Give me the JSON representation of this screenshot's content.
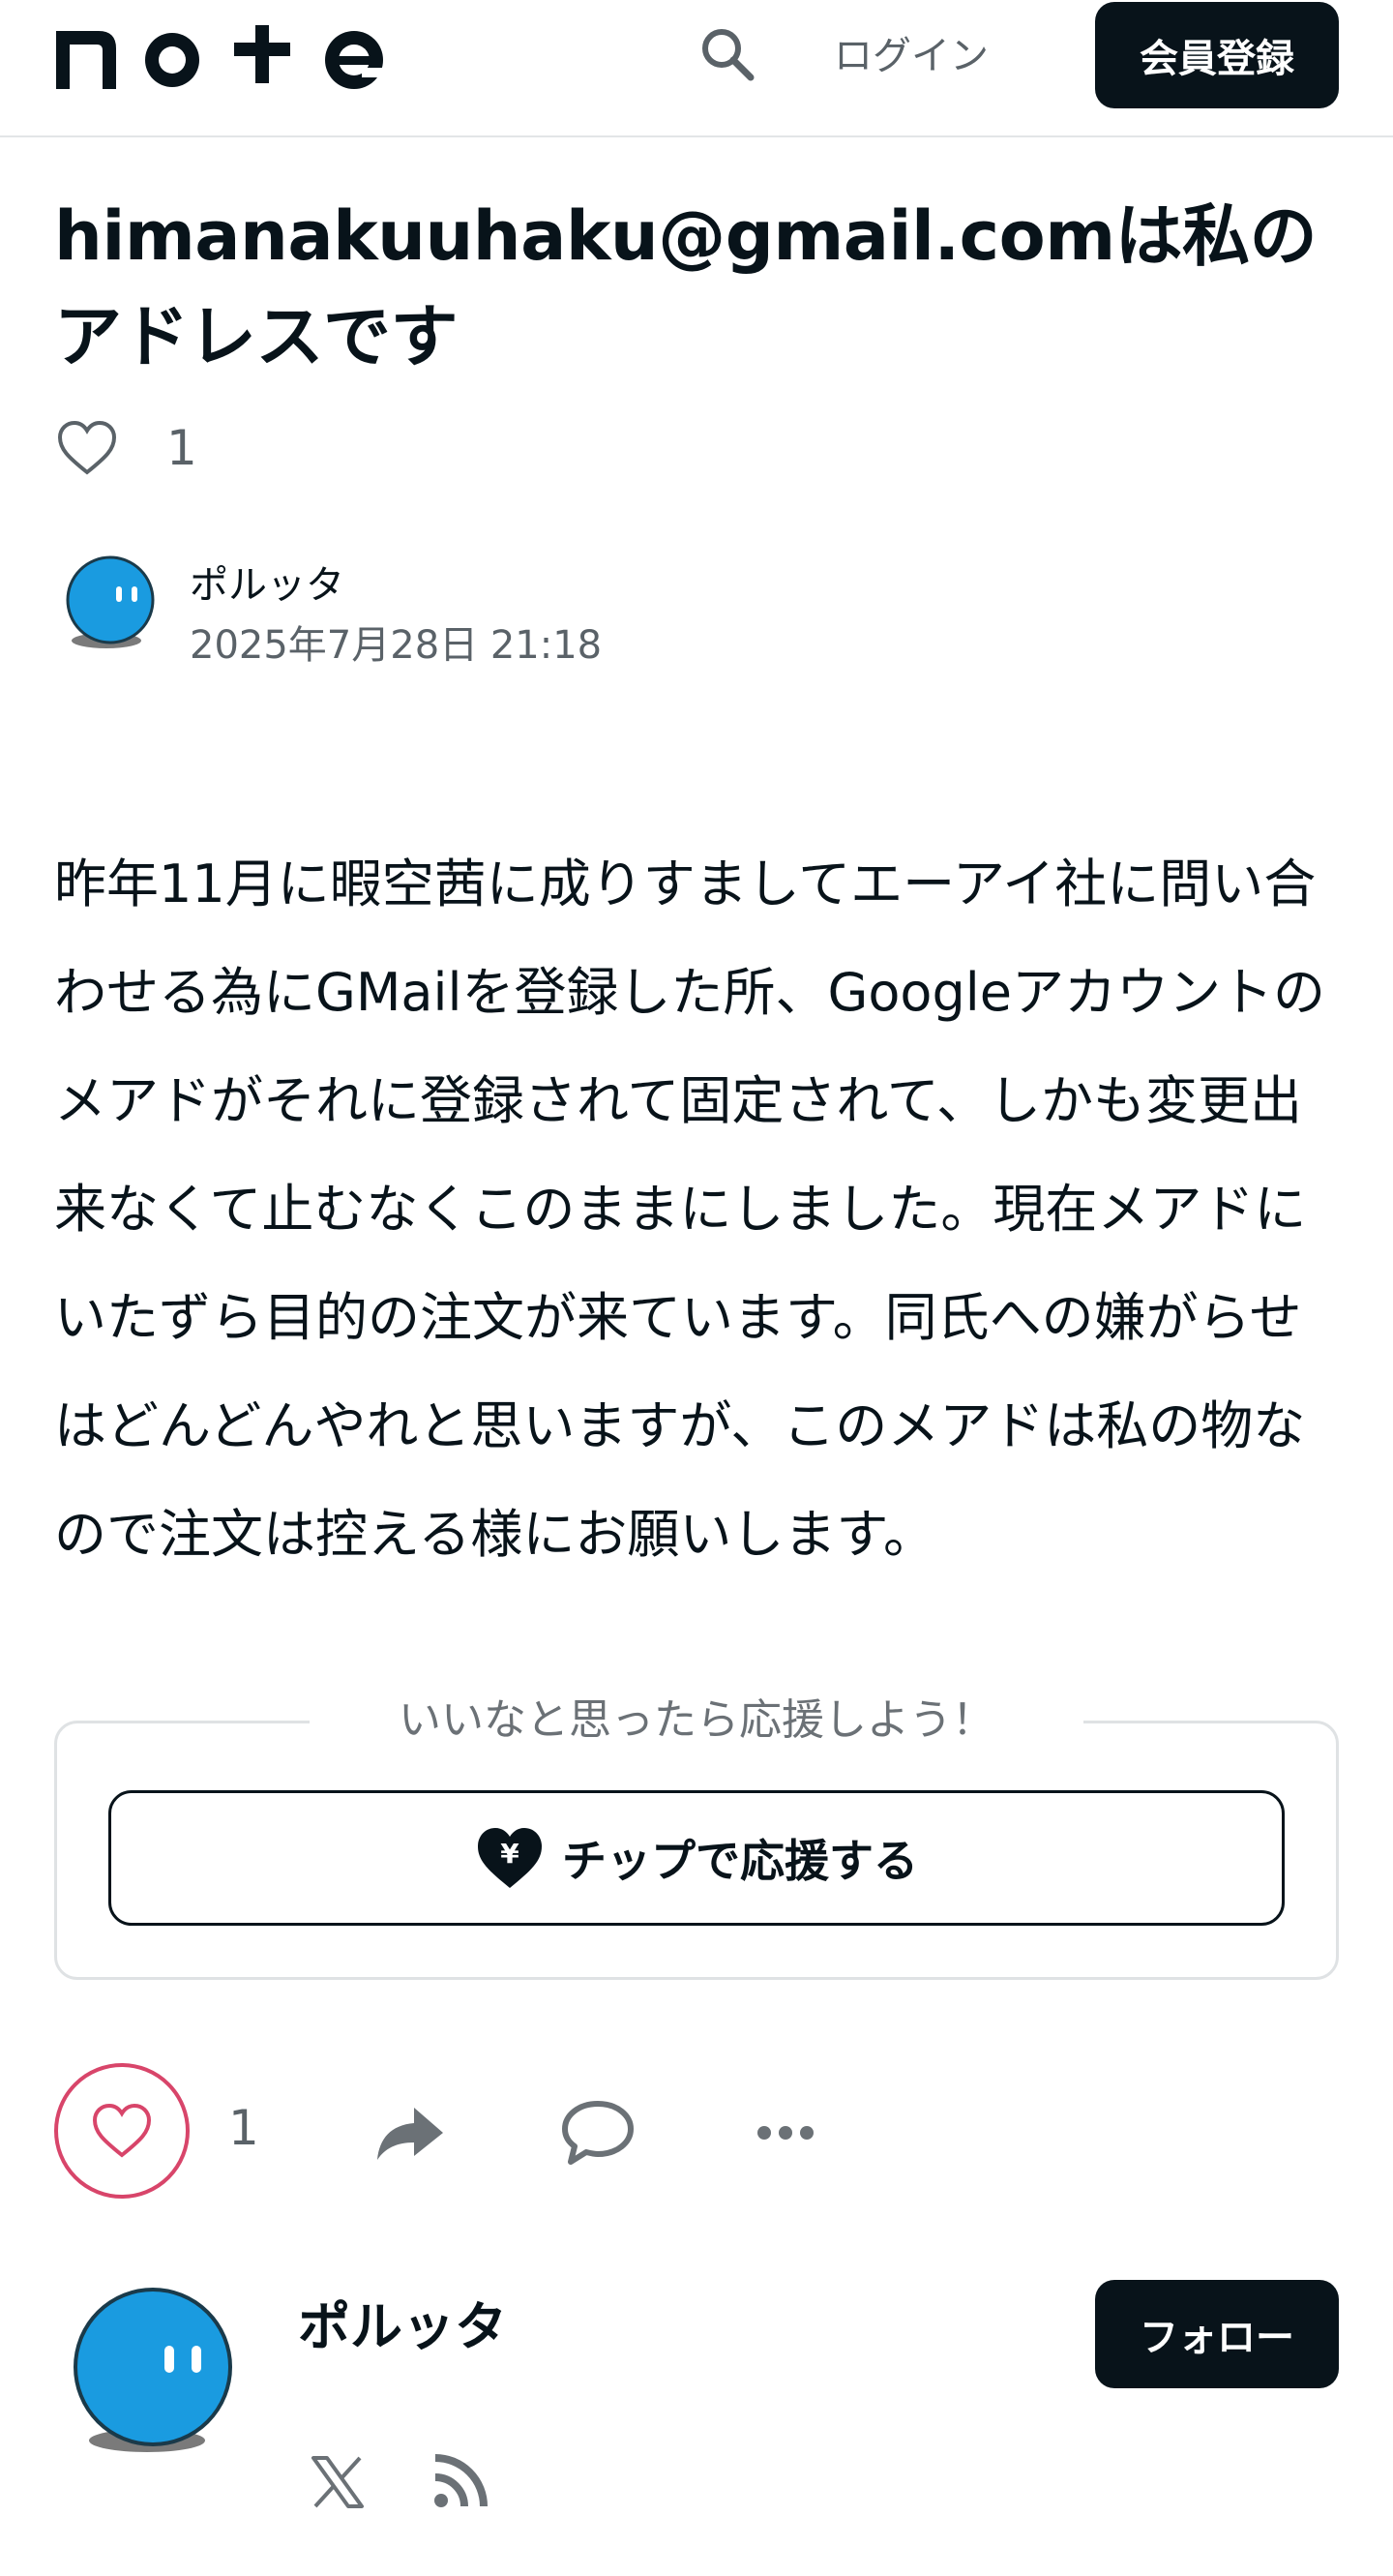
{
  "header": {
    "logo_text": "note",
    "search_icon": "search-icon",
    "login_label": "ログイン",
    "signup_label": "会員登録"
  },
  "article": {
    "title": "himanakuuhaku@gmail.comは私のアドレスです",
    "like_count": "1",
    "author_name": "ポルッタ",
    "date": "2025年7月28日 21:18",
    "body": "昨年11月に暇空茜に成りすましてエーアイ社に問い合わせる為にGMailを登録した所、Googleアカウントのメアドがそれに登録されて固定されて、しかも変更出来なくて止むなくこのままにしました。現在メアドにいたずら目的の注文が来ています。同氏への嫌がらせはどんどんやれと思いますが、このメアドは私の物なので注文は控える様にお願いします。"
  },
  "support": {
    "label": "いいなと思ったら応援しよう！",
    "tip_button_label": "チップで応援する"
  },
  "actions": {
    "like_count": "1",
    "icons": [
      "heart-icon",
      "share-icon",
      "comment-icon",
      "more-icon"
    ]
  },
  "creator": {
    "name": "ポルッタ",
    "follow_label": "フォロー",
    "social_icons": [
      "x-icon",
      "rss-icon"
    ]
  },
  "colors": {
    "primary_dark": "#08131a",
    "like_accent": "#d8456a",
    "avatar_blue": "#1a9be0",
    "muted_text": "#5a6268",
    "border": "#dfe2e4"
  }
}
